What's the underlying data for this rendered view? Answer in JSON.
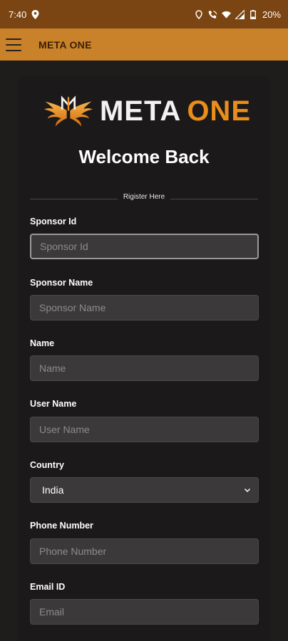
{
  "status_bar": {
    "time": "7:40",
    "battery": "20%"
  },
  "app_bar": {
    "title": "META ONE"
  },
  "logo": {
    "word_meta": "META",
    "word_one": "ONE",
    "brand_orange": "#e98d1b"
  },
  "form": {
    "heading": "Welcome Back",
    "divider_text": "Rigister Here",
    "fields": [
      {
        "label": "Sponsor Id",
        "placeholder": "Sponsor Id"
      },
      {
        "label": "Sponsor Name",
        "placeholder": "Sponsor Name"
      },
      {
        "label": "Name",
        "placeholder": "Name"
      },
      {
        "label": "User Name",
        "placeholder": "User Name"
      },
      {
        "label": "Country",
        "value": "India"
      },
      {
        "label": "Phone Number",
        "placeholder": "Phone Number"
      },
      {
        "label": "Email ID",
        "placeholder": "Email"
      }
    ]
  },
  "colors": {
    "status_bar": "#7a4512",
    "app_bar": "#c9822a",
    "background": "#1f1c1c",
    "input_bg": "#3b3939"
  }
}
